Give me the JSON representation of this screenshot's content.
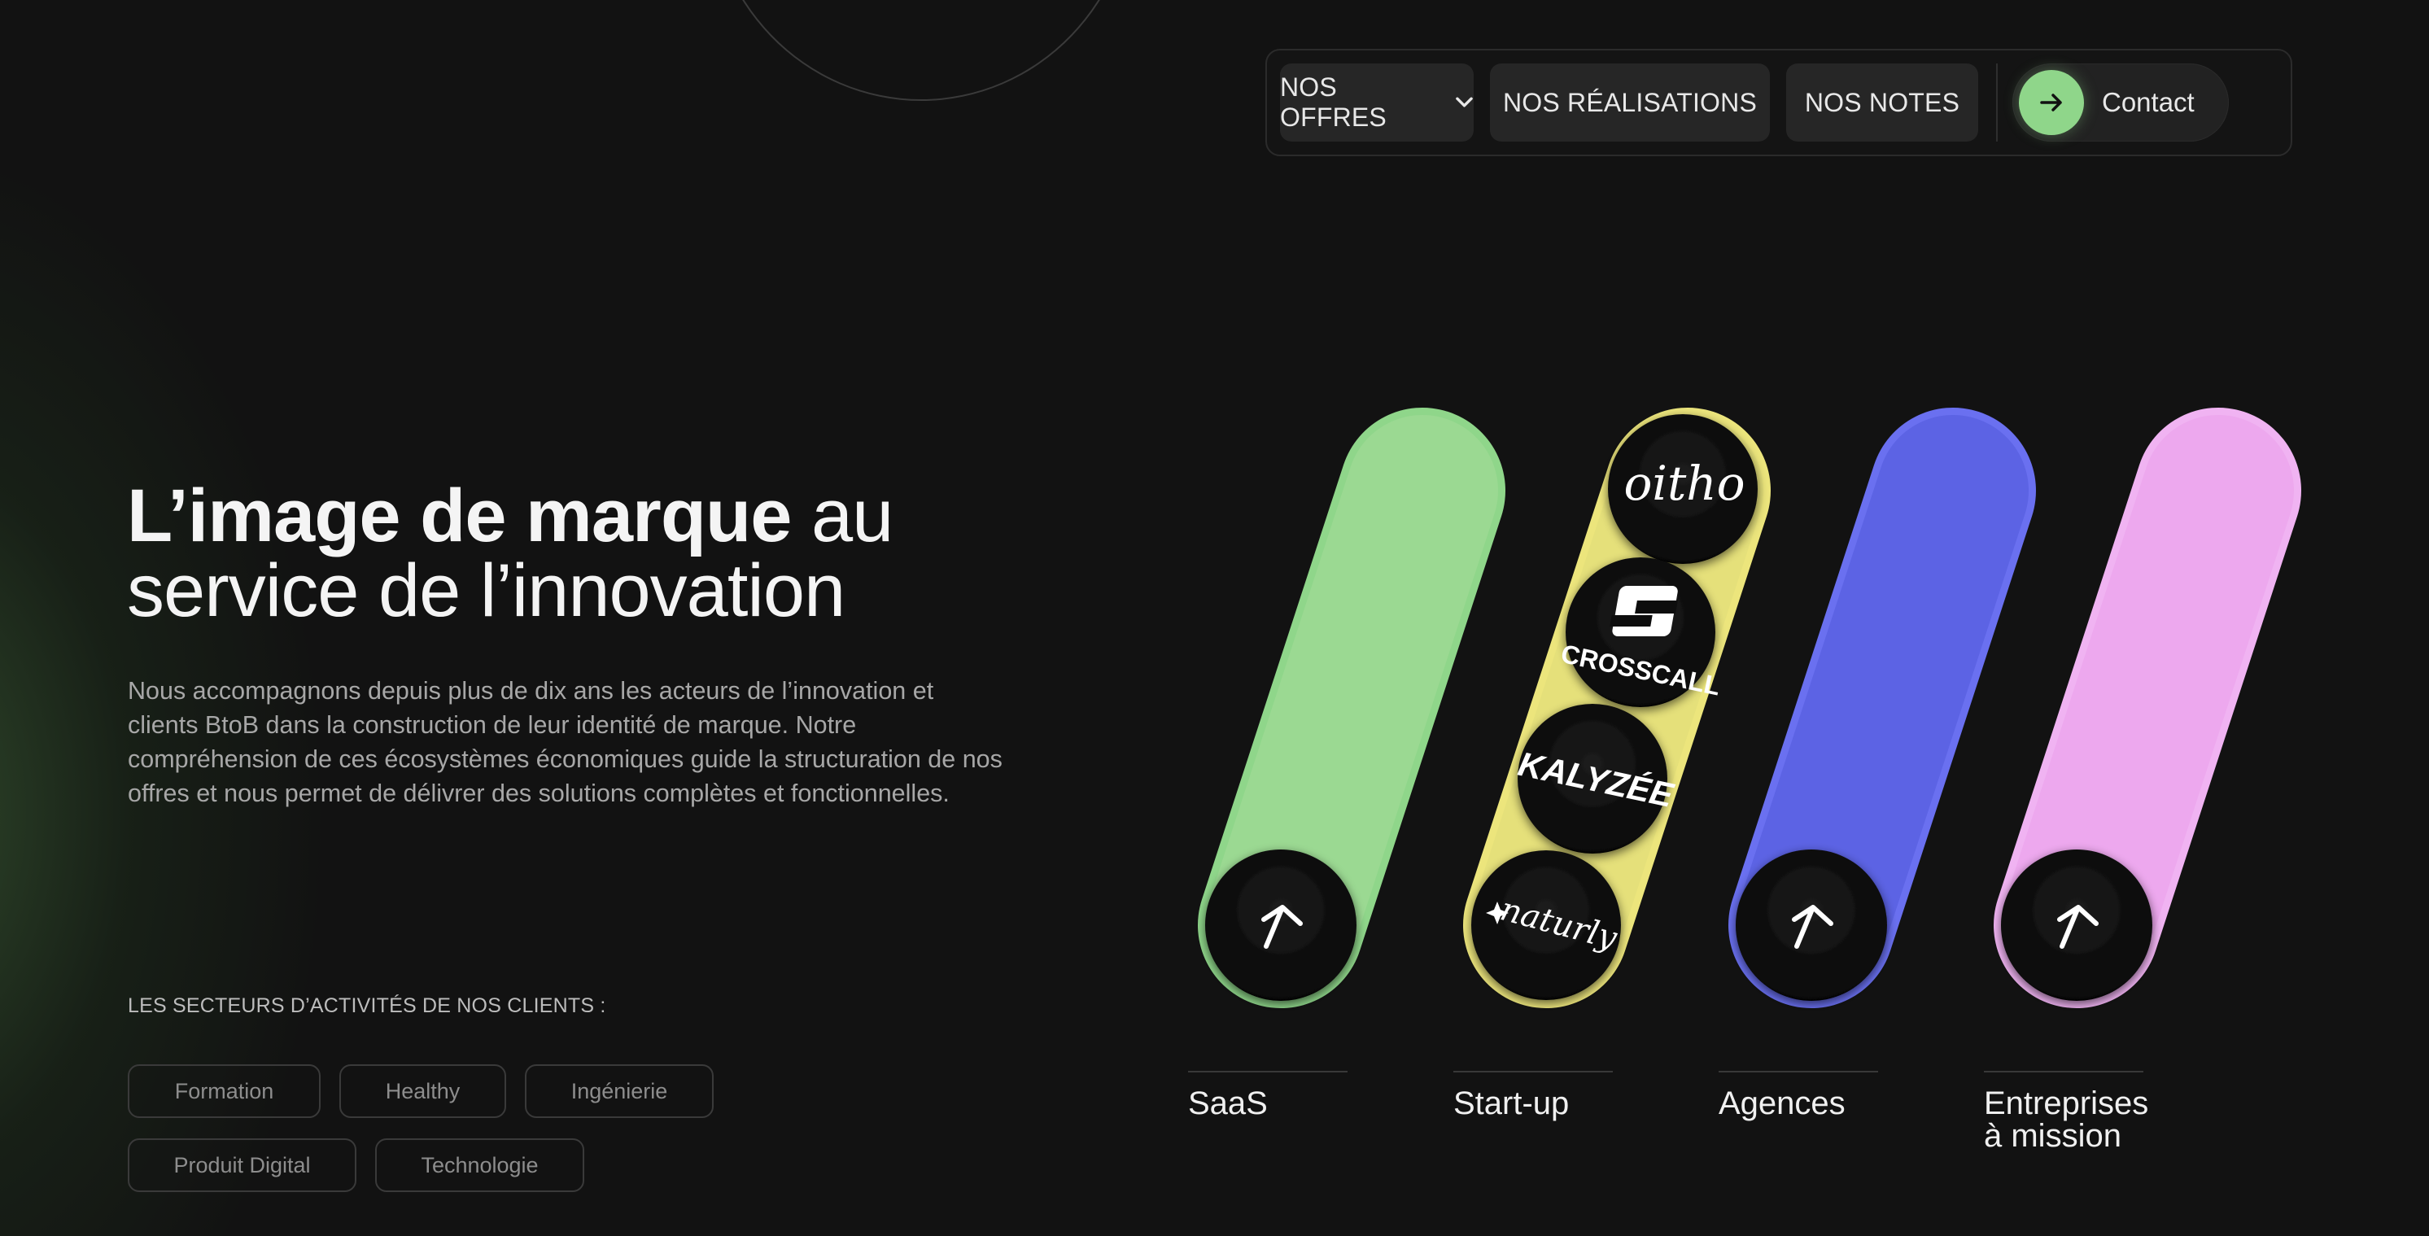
{
  "nav": {
    "offres_label": "NOS OFFRES",
    "realisations_label": "NOS RÉALISATIONS",
    "notes_label": "NOS NOTES",
    "contact_label": "Contact"
  },
  "hero": {
    "title_bold": "L’image de marque",
    "title_rest": " au",
    "title_line2": "service de l’innovation",
    "description": "Nous accompagnons depuis plus de dix ans les acteurs de l’innovation et clients BtoB dans la construction de leur identité de marque. Notre compréhension de ces écosystèmes économiques guide la structuration de nos offres et nous permet de délivrer des solutions complètes et fonctionnelles."
  },
  "sectors": {
    "label": "LES SECTEURS D’ACTIVITÉS DE NOS CLIENTS :",
    "tags": [
      "Formation",
      "Healthy",
      "Ingénierie",
      "Produit Digital",
      "Technologie"
    ]
  },
  "categories": [
    {
      "label": "SaaS",
      "color": "#9bd992",
      "border": "#8fd68a"
    },
    {
      "label": "Start-up",
      "color": "#e5e07a",
      "border": "#ece57c"
    },
    {
      "label": "Agences",
      "color": "#5c63e4",
      "border": "#6a70f0"
    },
    {
      "label": "Entreprises",
      "label2": "à mission",
      "color": "#eda8ee",
      "border": "#f0b3f2"
    }
  ],
  "startup_logos": [
    "oitho",
    "CROSSCALL",
    "KALYZÉE",
    "naturly"
  ],
  "colors": {
    "background": "#121212",
    "accent_green": "#8fd68a"
  }
}
